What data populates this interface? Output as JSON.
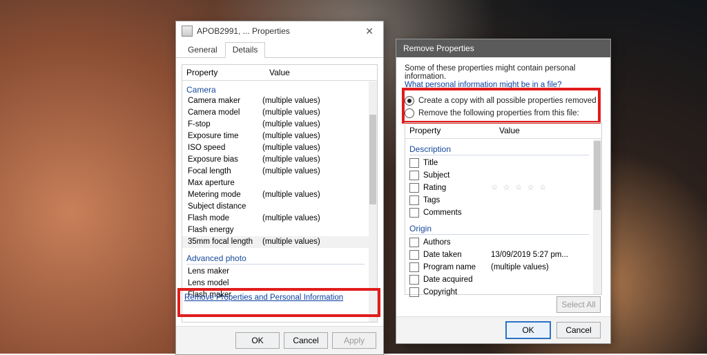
{
  "properties_dialog": {
    "title": "APOB2991, ... Properties",
    "tabs": {
      "general": "General",
      "details": "Details"
    },
    "columns": {
      "property": "Property",
      "value": "Value"
    },
    "group_camera": "Camera",
    "rows": [
      {
        "p": "Camera maker",
        "v": "(multiple values)"
      },
      {
        "p": "Camera model",
        "v": "(multiple values)"
      },
      {
        "p": "F-stop",
        "v": "(multiple values)"
      },
      {
        "p": "Exposure time",
        "v": "(multiple values)"
      },
      {
        "p": "ISO speed",
        "v": "(multiple values)"
      },
      {
        "p": "Exposure bias",
        "v": "(multiple values)"
      },
      {
        "p": "Focal length",
        "v": "(multiple values)"
      },
      {
        "p": "Max aperture",
        "v": ""
      },
      {
        "p": "Metering mode",
        "v": "(multiple values)"
      },
      {
        "p": "Subject distance",
        "v": ""
      },
      {
        "p": "Flash mode",
        "v": "(multiple values)"
      },
      {
        "p": "Flash energy",
        "v": ""
      },
      {
        "p": "35mm focal length",
        "v": "(multiple values)"
      }
    ],
    "group_advanced": "Advanced photo",
    "rows2": [
      {
        "p": "Lens maker",
        "v": ""
      },
      {
        "p": "Lens model",
        "v": ""
      },
      {
        "p": "Flash maker",
        "v": ""
      }
    ],
    "remove_link": "Remove Properties and Personal Information",
    "buttons": {
      "ok": "OK",
      "cancel": "Cancel",
      "apply": "Apply"
    }
  },
  "remove_dialog": {
    "title": "Remove Properties",
    "intro": "Some of these properties might contain personal information.",
    "info_link": "What personal information might be in a file?",
    "option_copy": "Create a copy with all possible properties removed",
    "option_remove": "Remove the following properties from this file:",
    "columns": {
      "property": "Property",
      "value": "Value"
    },
    "group_desc": "Description",
    "desc_rows": [
      {
        "p": "Title",
        "v": ""
      },
      {
        "p": "Subject",
        "v": ""
      },
      {
        "p": "Rating",
        "v": "★★★★★",
        "stars": true
      },
      {
        "p": "Tags",
        "v": ""
      },
      {
        "p": "Comments",
        "v": ""
      }
    ],
    "group_origin": "Origin",
    "origin_rows": [
      {
        "p": "Authors",
        "v": ""
      },
      {
        "p": "Date taken",
        "v": "13/09/2019 5:27 pm..."
      },
      {
        "p": "Program name",
        "v": "(multiple values)"
      },
      {
        "p": "Date acquired",
        "v": ""
      },
      {
        "p": "Copyright",
        "v": ""
      }
    ],
    "select_all": "Select All",
    "buttons": {
      "ok": "OK",
      "cancel": "Cancel"
    }
  }
}
